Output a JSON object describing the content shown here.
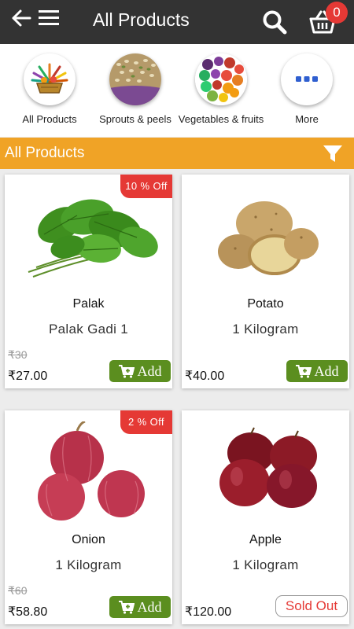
{
  "header": {
    "title": "All Products",
    "cart_count": "0",
    "icons": [
      "back-arrow-icon",
      "hamburger-menu-icon",
      "search-icon",
      "cart-icon"
    ]
  },
  "categories": [
    {
      "label": "All Products",
      "icon": "basket-logo-icon"
    },
    {
      "label": "Sprouts & peels",
      "icon": "sprouts-image"
    },
    {
      "label": "Vegetables & fruits",
      "icon": "vegetables-image"
    },
    {
      "label": "More",
      "icon": "more-dots-icon"
    }
  ],
  "section": {
    "title": "All Products",
    "icon": "filter-icon"
  },
  "products": [
    {
      "name": "Palak",
      "unit": "Palak Gadi 1",
      "old_price": "₹30",
      "price": "₹27.00",
      "discount": "10 % Off",
      "action": "Add"
    },
    {
      "name": "Potato",
      "unit": "1 Kilogram",
      "price": "₹40.00",
      "action": "Add"
    },
    {
      "name": "Onion",
      "unit": "1 Kilogram",
      "old_price": "₹60",
      "price": "₹58.80",
      "discount": "2 % Off",
      "action": "Add"
    },
    {
      "name": "Apple",
      "unit": "1 Kilogram",
      "price": "₹120.00",
      "action": "Sold Out"
    }
  ],
  "colors": {
    "topbar": "#333333",
    "section": "#f0a326",
    "add_button": "#5b8e1f",
    "badge": "#e53935"
  }
}
